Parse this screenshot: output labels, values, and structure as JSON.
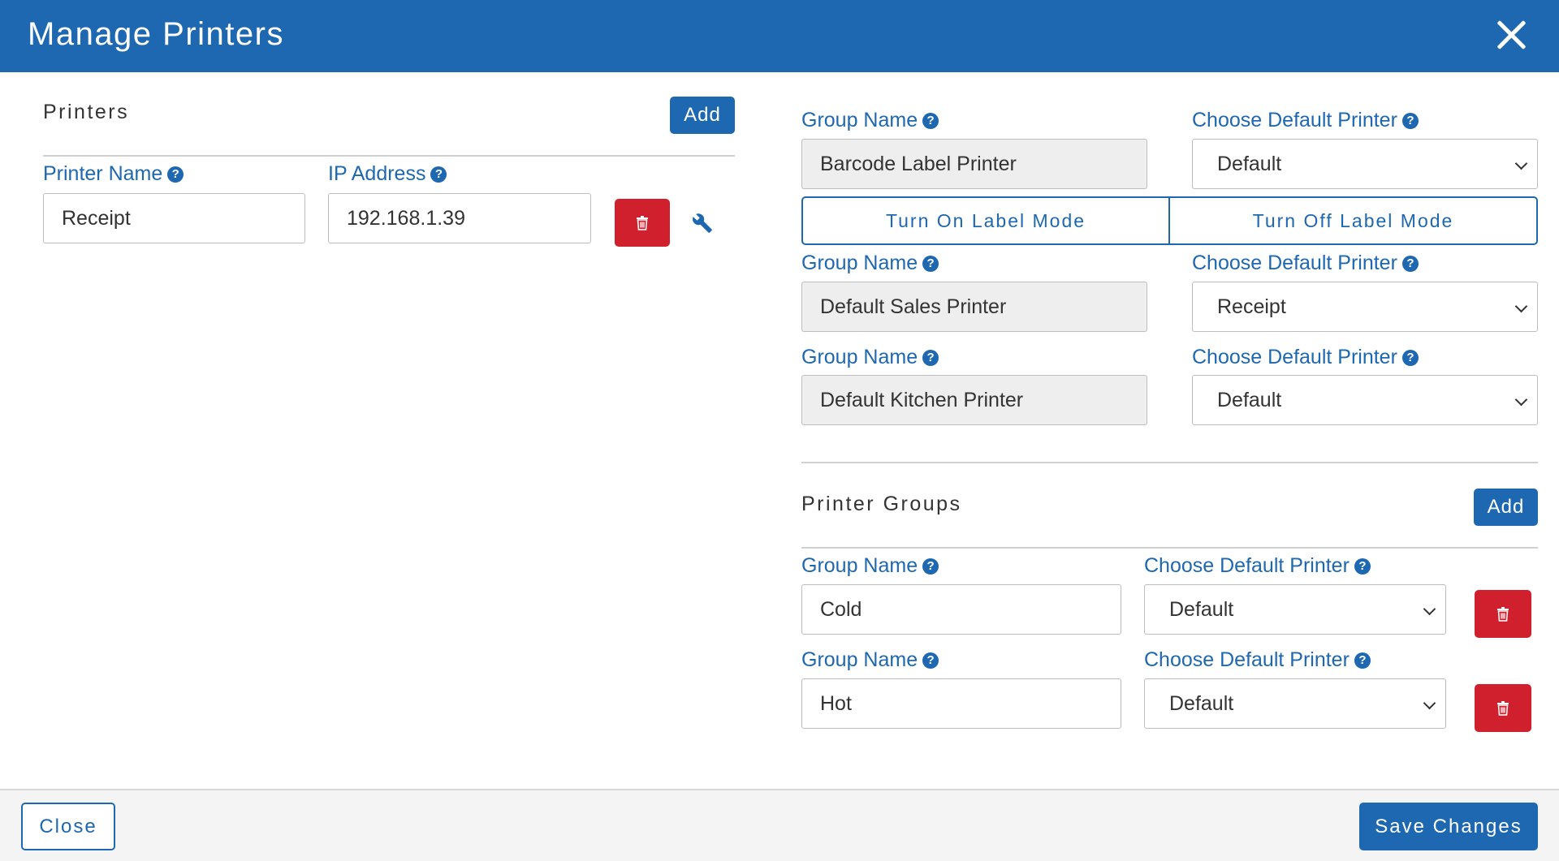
{
  "header": {
    "title": "Manage Printers"
  },
  "printers": {
    "title": "Printers",
    "add_label": "Add",
    "name_label": "Printer Name",
    "ip_label": "IP Address",
    "items": [
      {
        "name": "Receipt",
        "ip": "192.168.1.39"
      }
    ]
  },
  "default_groups": [
    {
      "group_label": "Group Name",
      "printer_label": "Choose Default Printer",
      "name": "Barcode Label Printer",
      "printer": "Default"
    },
    {
      "group_label": "Group Name",
      "printer_label": "Choose Default Printer",
      "name": "Default Sales Printer",
      "printer": "Receipt"
    },
    {
      "group_label": "Group Name",
      "printer_label": "Choose Default Printer",
      "name": "Default Kitchen Printer",
      "printer": "Default"
    }
  ],
  "label_mode": {
    "on_label": "Turn On Label Mode",
    "off_label": "Turn Off Label Mode"
  },
  "printer_groups": {
    "title": "Printer Groups",
    "add_label": "Add",
    "items": [
      {
        "group_label": "Group Name",
        "printer_label": "Choose Default Printer",
        "name": "Cold",
        "printer": "Default"
      },
      {
        "group_label": "Group Name",
        "printer_label": "Choose Default Printer",
        "name": "Hot",
        "printer": "Default"
      }
    ]
  },
  "footer": {
    "close_label": "Close",
    "save_label": "Save Changes"
  },
  "colors": {
    "primary": "#1e67b1",
    "danger": "#d0202e",
    "readonly_bg": "#eeeeee"
  },
  "icons": {
    "close": "close-icon",
    "help": "question-circle-icon",
    "delete": "trash-icon",
    "settings": "wrench-icon",
    "dropdown": "chevron-down-icon"
  }
}
